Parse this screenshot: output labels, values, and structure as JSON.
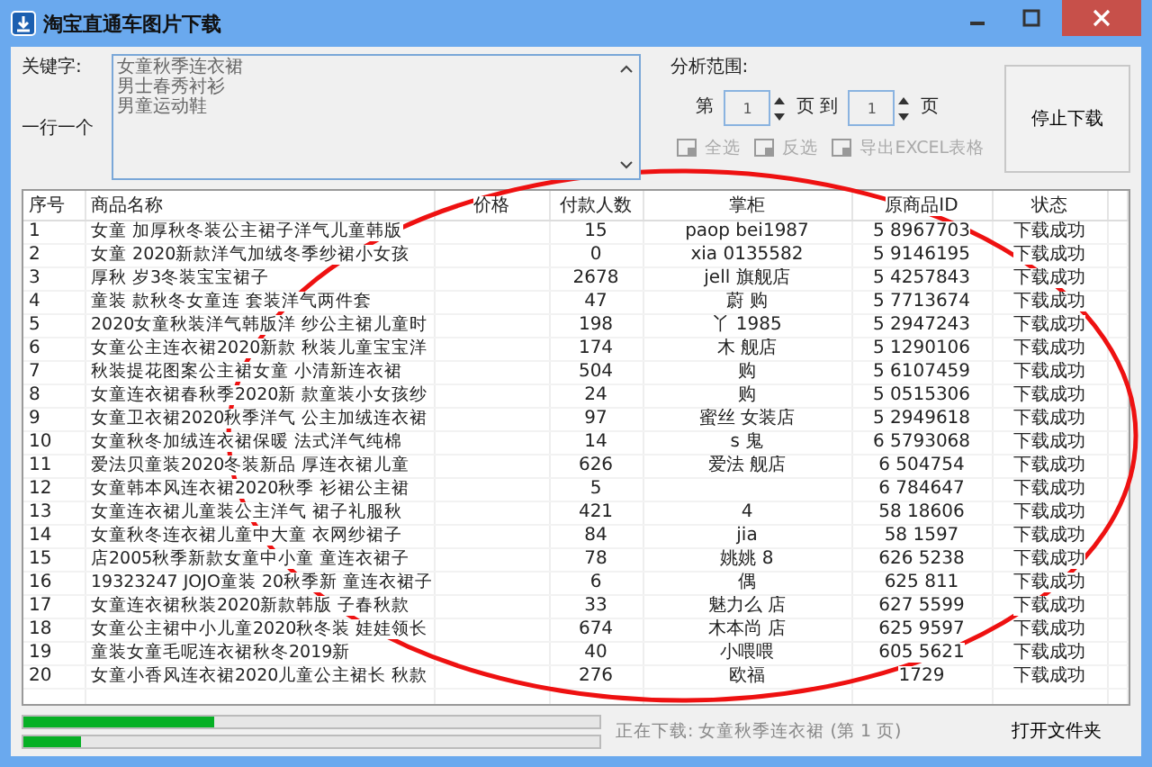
{
  "window": {
    "title": "淘宝直通车图片下载"
  },
  "keywords": {
    "label": "关键字:",
    "hint": "一行一个",
    "lines": [
      "女童秋季连衣裙",
      "男士春秀衬衫",
      "男童运动鞋"
    ]
  },
  "range": {
    "label": "分析范围:",
    "from_prefix": "第",
    "from_value": "1",
    "mid": "页 到",
    "to_value": "1",
    "suffix": "页"
  },
  "stop_button": "停止下载",
  "actions": [
    {
      "label": "全选",
      "disabled": true
    },
    {
      "label": "反选",
      "disabled": true
    },
    {
      "label": "导出EXCEL表格",
      "disabled": true
    }
  ],
  "table": {
    "columns": [
      "序号",
      "商品名称",
      "价格",
      "付款人数",
      "掌柜",
      "原商品ID",
      "状态"
    ],
    "rows": [
      [
        "1",
        "女童 加厚秋冬装公主裙子洋气儿童韩版",
        "",
        "15",
        "paop bei1987",
        "5 8967703",
        "下载成功"
      ],
      [
        "2",
        "女童 2020新款洋气加绒冬季纱裙小女孩",
        "",
        "0",
        "xia 0135582",
        "5 9146195",
        "下载成功"
      ],
      [
        "3",
        "厚秋 岁3冬装宝宝裙子",
        "",
        "2678",
        "jell 旗舰店",
        "5 4257843",
        "下载成功"
      ],
      [
        "4",
        "童装 款秋冬女童连 套装洋气两件套",
        "",
        "47",
        "蔚 购",
        "5 7713674",
        "下载成功"
      ],
      [
        "5",
        "2020女童秋装洋气韩版洋 纱公主裙儿童时",
        "",
        "198",
        "丫 1985",
        "5 2947243",
        "下载成功"
      ],
      [
        "6",
        "女童公主连衣裙2020新款 秋装儿童宝宝洋",
        "",
        "174",
        "木 舰店",
        "5 1290106",
        "下载成功"
      ],
      [
        "7",
        "秋装提花图案公主裙女童 小清新连衣裙",
        "",
        "504",
        "购",
        "5 6107459",
        "下载成功"
      ],
      [
        "8",
        "女童连衣裙春秋季2020新 款童装小女孩纱",
        "",
        "24",
        "购",
        "5 0515306",
        "下载成功"
      ],
      [
        "9",
        "女童卫衣裙2020秋季洋气 公主加绒连衣裙",
        "",
        "97",
        "蜜丝 女装店",
        "5 2949618",
        "下载成功"
      ],
      [
        "10",
        "女童秋冬加绒连衣裙保暖 法式洋气纯棉",
        "",
        "14",
        "s 鬼",
        "6 5793068",
        "下载成功"
      ],
      [
        "11",
        "爱法贝童装2020冬装新品 厚连衣裙儿童",
        "",
        "626",
        "爱法 舰店",
        "6 504754",
        "下载成功"
      ],
      [
        "12",
        "女童韩本风连衣裙2020秋季 衫裙公主裙",
        "",
        "5",
        "",
        "6 784647",
        "下载成功"
      ],
      [
        "13",
        "女童连衣裙儿童装公主洋气 裙子礼服秋",
        "",
        "421",
        "4",
        "58 18606",
        "下载成功"
      ],
      [
        "14",
        "女童秋冬连衣裙儿童中大童 衣网纱裙子",
        "",
        "84",
        "jia",
        "58 1597",
        "下载成功"
      ],
      [
        "15",
        "店2005秋季新款女童中小童 童连衣裙子",
        "",
        "78",
        "姚姚 8",
        "626 5238",
        "下载成功"
      ],
      [
        "16",
        "19323247 JOJO童装 20秋季新 童连衣裙子",
        "",
        "6",
        "偶",
        "625 811",
        "下载成功"
      ],
      [
        "17",
        "女童连衣裙秋装2020新款韩版 子春秋款",
        "",
        "33",
        "魅力么 店",
        "627 5599",
        "下载成功"
      ],
      [
        "18",
        "女童公主裙中小儿童2020秋冬装 娃娃领长",
        "",
        "674",
        "木本尚 店",
        "625 9597",
        "下载成功"
      ],
      [
        "19",
        "童装女童毛呢连衣裙秋冬2019新",
        "",
        "40",
        "小喂喂",
        "605 5621",
        "下载成功"
      ],
      [
        "20",
        "女童小香风连衣裙2020儿童公主裙长 秋款",
        "",
        "276",
        "欧福",
        "1729",
        "下载成功"
      ]
    ]
  },
  "progress": [
    {
      "level": 0.33
    },
    {
      "level": 0.1
    }
  ],
  "status": "正在下载: 女童秋季连衣裙 (第 1 页)",
  "open_folder_button": "打开文件夹"
}
